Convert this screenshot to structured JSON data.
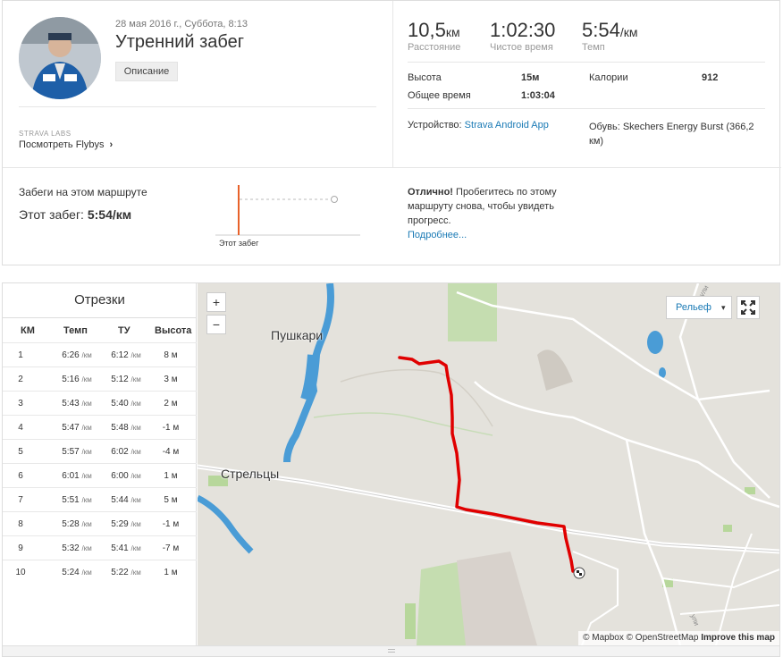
{
  "activity": {
    "date": "28 мая 2016 г., Суббота, 8:13",
    "title": "Утренний забег",
    "description_button": "Описание",
    "labs_label": "STRAVA LABS",
    "flybys_link": "Посмотреть Flybys",
    "flybys_chevron": "›"
  },
  "stats": {
    "distance_value": "10,5",
    "distance_unit": "км",
    "distance_label": "Расстояние",
    "moving_time_value": "1:02:30",
    "moving_time_label": "Чистое время",
    "pace_value": "5:54",
    "pace_unit": "/км",
    "pace_label": "Темп",
    "elevation_label": "Высота",
    "elevation_value": "15м",
    "calories_label": "Калории",
    "calories_value": "912",
    "elapsed_label": "Общее время",
    "elapsed_value": "1:03:04",
    "device_label": "Устройство:",
    "device_value": "Strava Android App",
    "shoes_label": "Обувь:",
    "shoes_value": "Skechers Energy Burst (366,2 км)"
  },
  "route": {
    "heading": "Забеги на этом маршруте",
    "this_run_label": "Этот забег:",
    "this_run_value": "5:54/км",
    "chart_caption": "Этот забег",
    "message_bold": "Отлично!",
    "message_text": "Пробегитесь по этому маршруту снова, чтобы увидеть прогресс.",
    "more_link": "Подробнее..."
  },
  "splits": {
    "title": "Отрезки",
    "columns": [
      "КМ",
      "Темп",
      "ТУ",
      "Высота"
    ],
    "rows": [
      {
        "km": "1",
        "pace": "6:26",
        "pace_unit": "/км",
        "gap": "6:12",
        "gap_unit": "/км",
        "elev": "8 м"
      },
      {
        "km": "2",
        "pace": "5:16",
        "pace_unit": "/км",
        "gap": "5:12",
        "gap_unit": "/км",
        "elev": "3 м"
      },
      {
        "km": "3",
        "pace": "5:43",
        "pace_unit": "/км",
        "gap": "5:40",
        "gap_unit": "/км",
        "elev": "2 м"
      },
      {
        "km": "4",
        "pace": "5:47",
        "pace_unit": "/км",
        "gap": "5:48",
        "gap_unit": "/км",
        "elev": "-1 м"
      },
      {
        "km": "5",
        "pace": "5:57",
        "pace_unit": "/км",
        "gap": "6:02",
        "gap_unit": "/км",
        "elev": "-4 м"
      },
      {
        "km": "6",
        "pace": "6:01",
        "pace_unit": "/км",
        "gap": "6:00",
        "gap_unit": "/км",
        "elev": "1 м"
      },
      {
        "km": "7",
        "pace": "5:51",
        "pace_unit": "/км",
        "gap": "5:44",
        "gap_unit": "/км",
        "elev": "5 м"
      },
      {
        "km": "8",
        "pace": "5:28",
        "pace_unit": "/км",
        "gap": "5:29",
        "gap_unit": "/км",
        "elev": "-1 м"
      },
      {
        "km": "9",
        "pace": "5:32",
        "pace_unit": "/км",
        "gap": "5:41",
        "gap_unit": "/км",
        "elev": "-7 м"
      },
      {
        "km": "10",
        "pace": "5:24",
        "pace_unit": "/км",
        "gap": "5:22",
        "gap_unit": "/км",
        "elev": "1 м"
      }
    ]
  },
  "map": {
    "zoom_in": "+",
    "zoom_out": "−",
    "layer_select": "Рельеф",
    "layer_caret": "▾",
    "town_1": "Пушкари",
    "town_2": "Стрельцы",
    "street_1": "ули",
    "street_2": "ули",
    "attribution_mapbox": "© Mapbox",
    "attribution_osm": "© OpenStreetMap",
    "improve_link": "Improve this map",
    "route_color": "#e00000",
    "water_color": "#4a9cd6",
    "park_color": "#c5ddb0"
  },
  "colors": {
    "accent": "#e8622a",
    "link": "#1a7ab5"
  }
}
